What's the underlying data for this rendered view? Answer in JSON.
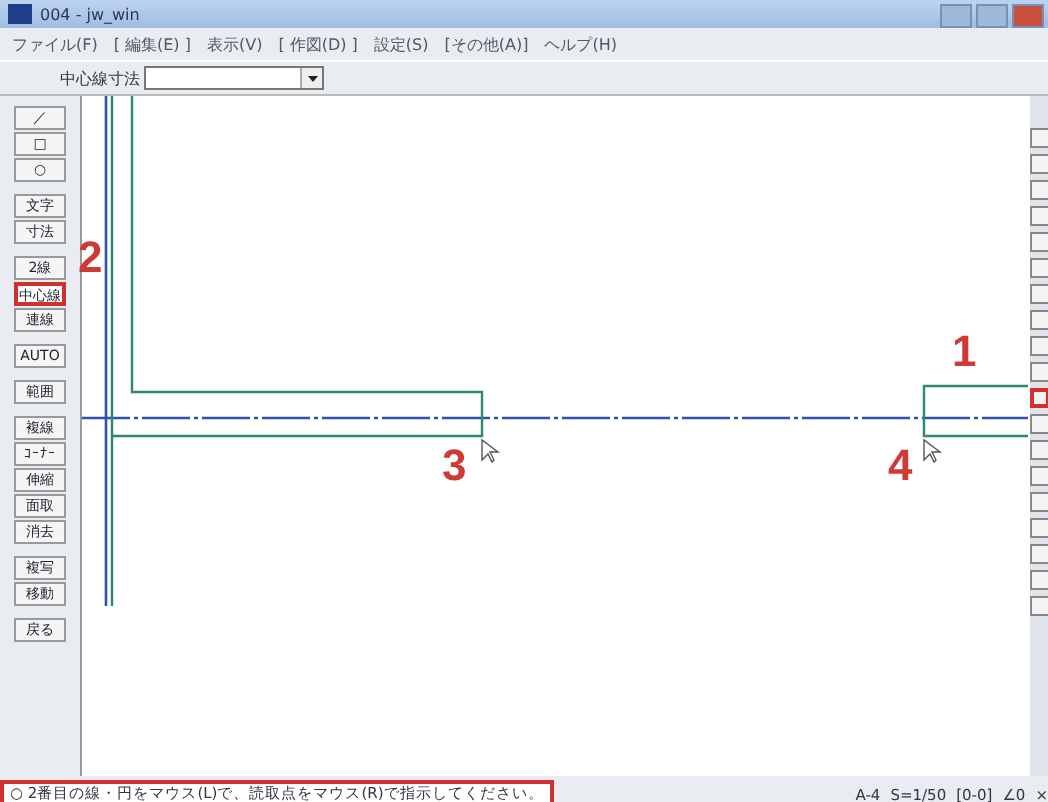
{
  "window": {
    "title": "004 - jw_win"
  },
  "menu": [
    "ファイル(F)",
    "[ 編集(E) ]",
    "表示(V)",
    "[ 作図(D) ]",
    "設定(S)",
    "[その他(A)]",
    "ヘルプ(H)"
  ],
  "toolbar": {
    "label": "中心線寸法"
  },
  "left_tool_groups": [
    [
      {
        "label": "／",
        "selected": false
      },
      {
        "label": "□",
        "selected": false
      },
      {
        "label": "○",
        "selected": false
      }
    ],
    [
      {
        "label": "文字",
        "selected": false
      },
      {
        "label": "寸法",
        "selected": false
      }
    ],
    [
      {
        "label": "2線",
        "selected": false
      },
      {
        "label": "中心線",
        "selected": true
      },
      {
        "label": "連線",
        "selected": false
      }
    ],
    [
      {
        "label": "AUTO",
        "selected": false
      }
    ],
    [
      {
        "label": "範囲",
        "selected": false
      }
    ],
    [
      {
        "label": "複線",
        "selected": false
      },
      {
        "label": "ｺｰﾅｰ",
        "selected": false
      },
      {
        "label": "伸縮",
        "selected": false
      },
      {
        "label": "面取",
        "selected": false
      },
      {
        "label": "消去",
        "selected": false
      }
    ],
    [
      {
        "label": "複写",
        "selected": false
      },
      {
        "label": "移動",
        "selected": false
      }
    ],
    [
      {
        "label": "戻る",
        "selected": false
      }
    ]
  ],
  "annotations": [
    "1",
    "2",
    "3",
    "4"
  ],
  "status_bar": {
    "message": "○ 2番目の線・円をマウス(L)で、読取点をマウス(R)で指示してください。",
    "paper": "A-4",
    "scale": "S=1/50",
    "layer": "[0-0]",
    "angle": "∠0",
    "extra": "×"
  }
}
